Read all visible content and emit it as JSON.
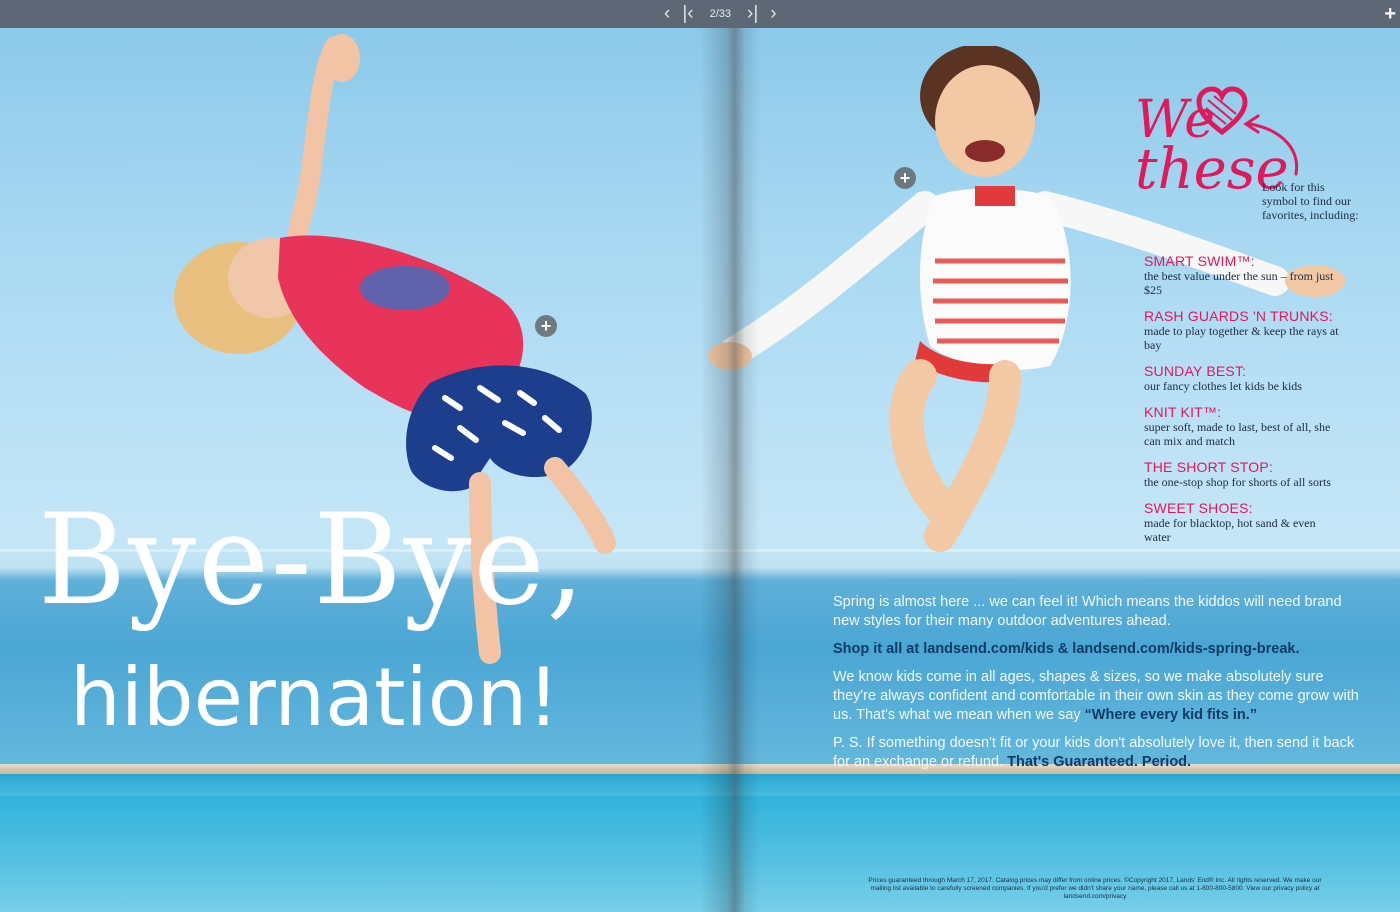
{
  "viewer": {
    "page_indicator": "2/33"
  },
  "headline": {
    "line1": "Bye-Bye,",
    "line2": "hibernation!"
  },
  "favorites": {
    "we_love_line1": "We",
    "we_love_line2": "these",
    "intro": "Look for this symbol to find our favorites, including:",
    "items": [
      {
        "title": "SMART SWIM™:",
        "desc": "the best value under the sun – from just $25"
      },
      {
        "title": "RASH GUARDS 'N TRUNKS:",
        "desc": "made to play together & keep the rays at bay"
      },
      {
        "title": "SUNDAY BEST:",
        "desc": "our fancy clothes let kids be kids"
      },
      {
        "title": "KNIT KIT™:",
        "desc": "super soft, made to last, best of all, she can mix and match"
      },
      {
        "title": "THE SHORT STOP:",
        "desc": "the one-stop shop for shorts of all sorts"
      },
      {
        "title": "SWEET SHOES:",
        "desc": "made for blacktop, hot sand & even water"
      }
    ]
  },
  "copy": {
    "p1": "Spring is almost here ... we can feel it! Which means the kiddos will need brand new styles for their many outdoor adventures ahead.",
    "shop": "Shop it all at landsend.com/kids & landsend.com/kids-spring-break.",
    "p3_a": "We know kids come in all ages, shapes & sizes, so we make absolutely sure they're always confident and comfortable in their own skin as they come grow with us. That's what we mean when we say",
    "p3_b": "“Where every kid fits in.”",
    "p4_a": "P. S. If something doesn't fit or your kids don't absolutely love it, then send it back for an exchange or refund.",
    "p4_b": "That's Guaranteed. Period."
  },
  "fineprint": "Prices guaranteed through March 17, 2017. Catalog prices may differ from online prices. ©Copyright 2017, Lands' End® Inc. All rights reserved. We make our mailing list available to carefully screened companies. If you'd prefer we didn't share your name, please call us at 1-800-800-5800. View our privacy policy at landsend.com/privacy",
  "colors": {
    "accent_pink": "#e0195d",
    "navy": "#133a66",
    "toolbar": "#5e6775"
  }
}
